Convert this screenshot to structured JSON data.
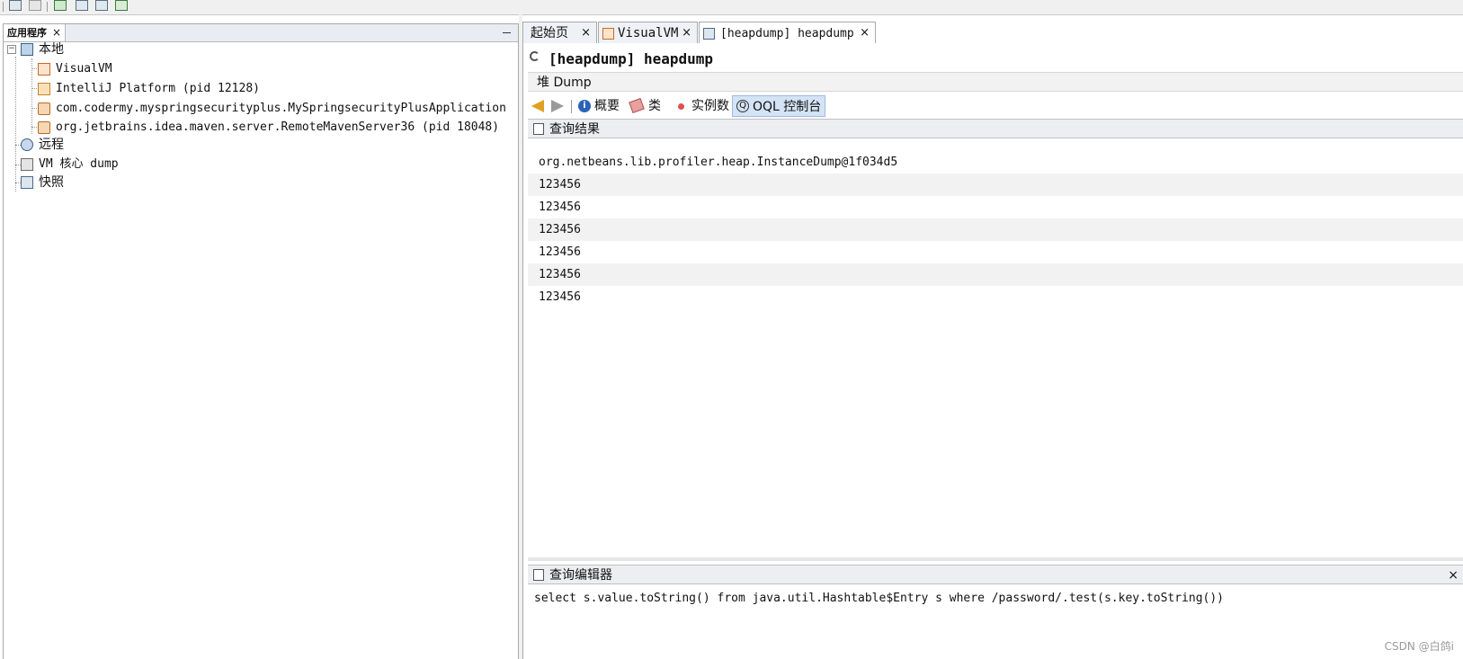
{
  "left_panel": {
    "tab_label": "应用程序",
    "close": "×",
    "tree": {
      "local": "本地",
      "visualvm": "VisualVM",
      "intellij": "IntelliJ Platform (pid 12128)",
      "app": "com.codermy.myspringsecurityplus.MySpringsecurityPlusApplication",
      "maven": "org.jetbrains.idea.maven.server.RemoteMavenServer36 (pid 18048)",
      "remote": "远程",
      "vm_core": "VM 核心 dump",
      "snapshot": "快照"
    }
  },
  "tabs": [
    {
      "label": "起始页",
      "close": "×"
    },
    {
      "label": "VisualVM",
      "close": "×"
    },
    {
      "label": "[heapdump] heapdump",
      "close": "×"
    }
  ],
  "doc": {
    "title": "[heapdump] heapdump",
    "heap_bar": "堆 Dump",
    "views": {
      "summary": "概要",
      "classes": "类",
      "instances": "实例数",
      "oql": "OQL 控制台"
    },
    "results_header": "查询结果",
    "results": [
      "org.netbeans.lib.profiler.heap.InstanceDump@1f034d5",
      "123456",
      "123456",
      "123456",
      "123456",
      "123456",
      "123456"
    ],
    "editor_header": "查询编辑器",
    "editor_close": "×",
    "query": "select s.value.toString() from java.util.Hashtable$Entry s where /password/.test(s.key.toString())"
  },
  "watermark": "CSDN @白鸽i",
  "colors": {
    "active_view_bg": "#d4e3f5",
    "arrow_back": "#e0a020",
    "info_icon": "#2a62b8"
  }
}
